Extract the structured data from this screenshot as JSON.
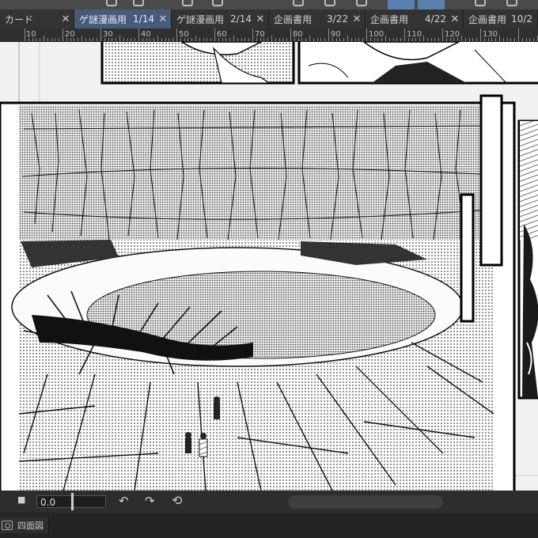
{
  "tabs": [
    {
      "name": "カード",
      "page": "",
      "active": false
    },
    {
      "name": "ゲ謎漫画用",
      "page": "1/14",
      "active": true
    },
    {
      "name": "ゲ謎漫画用",
      "page": "2/14",
      "active": false
    },
    {
      "name": "企画書用",
      "page": "3/22",
      "active": false
    },
    {
      "name": "企画書用",
      "page": "4/22",
      "active": false
    },
    {
      "name": "企画書用",
      "page": "10/2",
      "active": false
    }
  ],
  "ruler": {
    "labels": [
      "10",
      "20",
      "30",
      "40",
      "50",
      "60",
      "70",
      "80",
      "90",
      "100",
      "110",
      "120",
      "130"
    ]
  },
  "bottombar": {
    "stop_icon": "■",
    "angle_value": "0.0",
    "undo_icon": "↶",
    "redo_icon": "↷",
    "reset_icon": "⟲"
  },
  "statusbar": {
    "tab_label": "四面図"
  },
  "icons": {
    "close": "✕"
  }
}
